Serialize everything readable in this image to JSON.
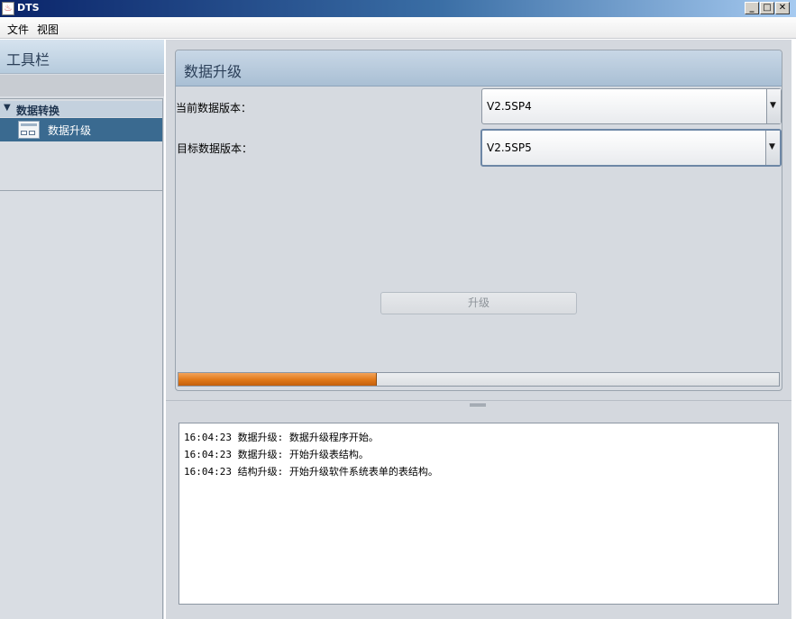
{
  "window": {
    "title": "DTS",
    "controls": {
      "minimize": "_",
      "maximize": "□",
      "close": "✕"
    }
  },
  "menu": {
    "items": [
      "文件",
      "视图"
    ]
  },
  "left_panel": {
    "toolbar_title": "工具栏",
    "group_label": "数据转换",
    "item_label": "数据升级"
  },
  "main": {
    "panel_title": "数据升级",
    "current_version_label": "当前数据版本：",
    "current_version_value": "V2.5SP4",
    "target_version_label": "目标数据版本：",
    "target_version_value": "V2.5SP5",
    "upgrade_button": "升级",
    "progress": 0.33
  },
  "log": {
    "lines": [
      "16:04:23 数据升级: 数据升级程序开始。",
      "16:04:23 数据升级: 开始升级表结构。",
      "16:04:23 结构升级: 开始升级软件系统表单的表结构。"
    ]
  },
  "icons": {
    "app": "java-app-icon",
    "tree_expand": "triangle-down-icon",
    "tree_item": "window-form-icon",
    "combo_arrow": "chevron-down-icon"
  }
}
